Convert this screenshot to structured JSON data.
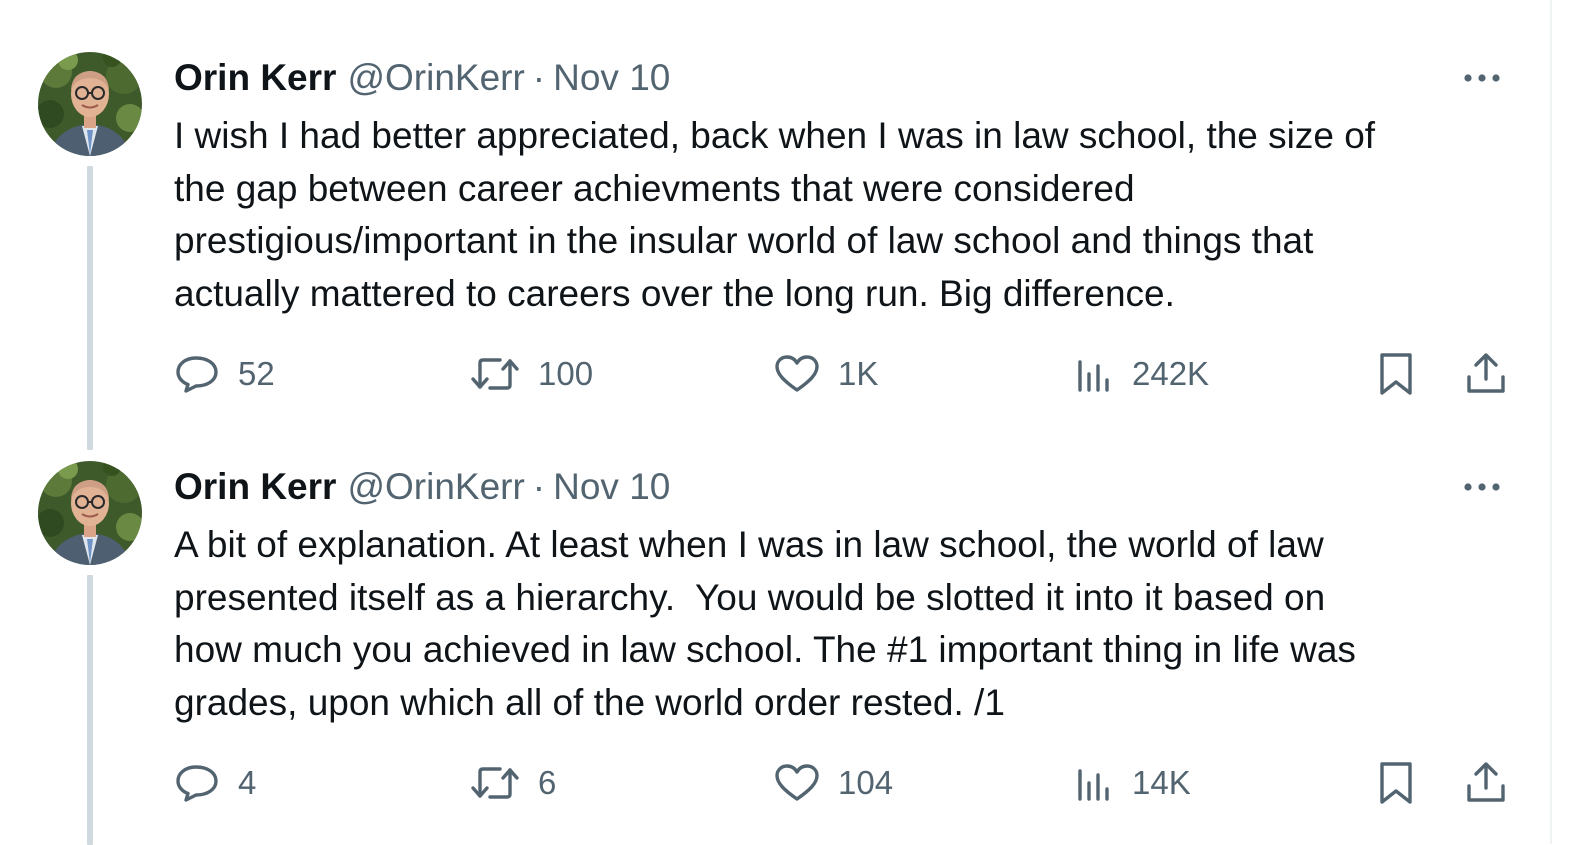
{
  "tweets": [
    {
      "author": {
        "name": "Orin Kerr",
        "handle": "@OrinKerr",
        "avatar": "profile-photo"
      },
      "separator": "·",
      "date": "Nov 10",
      "text": "I wish I had better appreciated, back when I was in law school, the size of\nthe gap between career achievments that were considered\nprestigious/important in the insular world of law school and things that\nactually mattered to careers over the long run. Big difference.",
      "stats": {
        "replies": "52",
        "reposts": "100",
        "likes": "1K",
        "views": "242K"
      }
    },
    {
      "author": {
        "name": "Orin Kerr",
        "handle": "@OrinKerr",
        "avatar": "profile-photo"
      },
      "separator": "·",
      "date": "Nov 10",
      "text": "A bit of explanation. At least when I was in law school, the world of law\npresented itself as a hierarchy.  You would be slotted it into it based on\nhow much you achieved in law school. The #1 important thing in life was\ngrades, upon which all of the world order rested. /1",
      "stats": {
        "replies": "4",
        "reposts": "6",
        "likes": "104",
        "views": "14K"
      }
    }
  ],
  "icons": {
    "more": "more-horizontal-icon",
    "reply": "reply-icon",
    "repost": "repost-icon",
    "like": "heart-icon",
    "views": "views-chart-icon",
    "bookmark": "bookmark-icon",
    "share": "share-icon"
  },
  "colors": {
    "text": "#0f1419",
    "secondary": "#536471",
    "thread_line": "#cfd9de",
    "background": "#ffffff"
  }
}
